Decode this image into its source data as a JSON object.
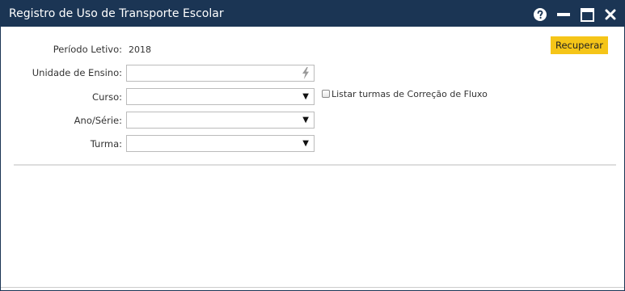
{
  "window": {
    "title": "Registro de Uso de Transporte Escolar",
    "titlebar_color": "#1b3554"
  },
  "titlebar_buttons": {
    "help_icon": "help-circle-icon",
    "minimize_icon": "minimize-icon",
    "maximize_icon": "maximize-icon",
    "close_icon": "close-icon"
  },
  "form": {
    "periodo_letivo": {
      "label": "Período Letivo:",
      "value": "2018"
    },
    "unidade_ensino": {
      "label": "Unidade de Ensino:",
      "value": "",
      "icon": "lightning-icon"
    },
    "curso": {
      "label": "Curso:",
      "value": ""
    },
    "ano_serie": {
      "label": "Ano/Série:",
      "value": ""
    },
    "turma": {
      "label": "Turma:",
      "value": ""
    },
    "correcao_fluxo": {
      "label": "Listar turmas de Correção de Fluxo",
      "checked": false
    }
  },
  "actions": {
    "recuperar_label": "Recuperar",
    "accent_color": "#f5c518"
  }
}
